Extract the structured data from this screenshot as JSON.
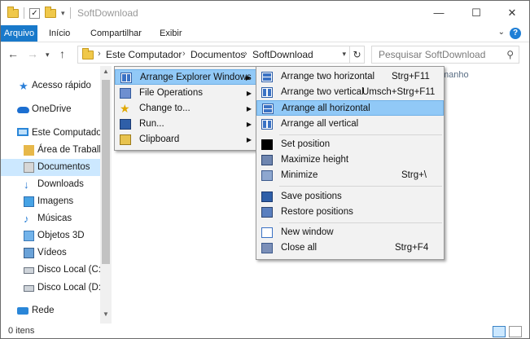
{
  "window": {
    "title": "SoftDownload",
    "controls": {
      "minimize": "—",
      "maximize": "☐",
      "close": "✕"
    }
  },
  "ribbon": {
    "tabs": [
      "Arquivo",
      "Início",
      "Compartilhar",
      "Exibir"
    ],
    "help_icon": "?"
  },
  "address": {
    "crumbs": [
      "Este Computador",
      "Documentos",
      "SoftDownload"
    ],
    "search_placeholder": "Pesquisar SoftDownload"
  },
  "nav": {
    "items": [
      {
        "label": "Acesso rápido",
        "icon": "star-icon"
      },
      {
        "label": "OneDrive",
        "icon": "cloud-icon"
      },
      {
        "label": "Este Computador",
        "icon": "computer-icon"
      },
      {
        "label": "Área de Trabalho",
        "icon": "folder-icon"
      },
      {
        "label": "Documentos",
        "icon": "documents-icon",
        "selected": true
      },
      {
        "label": "Downloads",
        "icon": "download-icon"
      },
      {
        "label": "Imagens",
        "icon": "images-icon"
      },
      {
        "label": "Músicas",
        "icon": "music-icon"
      },
      {
        "label": "Objetos 3D",
        "icon": "objects-3d-icon"
      },
      {
        "label": "Vídeos",
        "icon": "videos-icon"
      },
      {
        "label": "Disco Local (C:)",
        "icon": "disk-icon"
      },
      {
        "label": "Disco Local (D:)",
        "icon": "disk-icon"
      },
      {
        "label": "Rede",
        "icon": "network-icon"
      }
    ]
  },
  "content": {
    "column_header_partial": "manho"
  },
  "status": {
    "item_count": "0 itens"
  },
  "menu_main": {
    "items": [
      {
        "label": "Arrange Explorer Windows",
        "icon": "arrange-windows-icon",
        "has_submenu": true,
        "highlighted": true
      },
      {
        "label": "File Operations",
        "icon": "file-operations-icon",
        "has_submenu": true
      },
      {
        "label": "Change to...",
        "icon": "star-icon",
        "has_submenu": true
      },
      {
        "label": "Run...",
        "icon": "run-icon",
        "has_submenu": true
      },
      {
        "label": "Clipboard",
        "icon": "clipboard-icon",
        "has_submenu": true
      }
    ]
  },
  "menu_sub": {
    "items": [
      {
        "label": "Arrange two horizontal",
        "shortcut": "Strg+F11",
        "icon": "arrange-horizontal-icon"
      },
      {
        "label": "Arrange two vertical",
        "shortcut": "Umsch+Strg+F11",
        "icon": "arrange-vertical-icon"
      },
      {
        "label": "Arrange all horizontal",
        "shortcut": "",
        "icon": "arrange-all-horizontal-icon",
        "highlighted": true
      },
      {
        "label": "Arrange all vertical",
        "shortcut": "",
        "icon": "arrange-all-vertical-icon"
      },
      {
        "label": "Set position",
        "shortcut": "",
        "icon": "set-position-icon"
      },
      {
        "label": "Maximize height",
        "shortcut": "",
        "icon": "maximize-height-icon"
      },
      {
        "label": "Minimize",
        "shortcut": "Strg+\\",
        "icon": "minimize-icon"
      },
      {
        "label": "Save positions",
        "shortcut": "",
        "icon": "save-positions-icon"
      },
      {
        "label": "Restore positions",
        "shortcut": "",
        "icon": "restore-positions-icon"
      },
      {
        "label": "New window",
        "shortcut": "",
        "icon": "new-window-icon"
      },
      {
        "label": "Close all",
        "shortcut": "Strg+F4",
        "icon": "close-all-icon"
      }
    ]
  }
}
